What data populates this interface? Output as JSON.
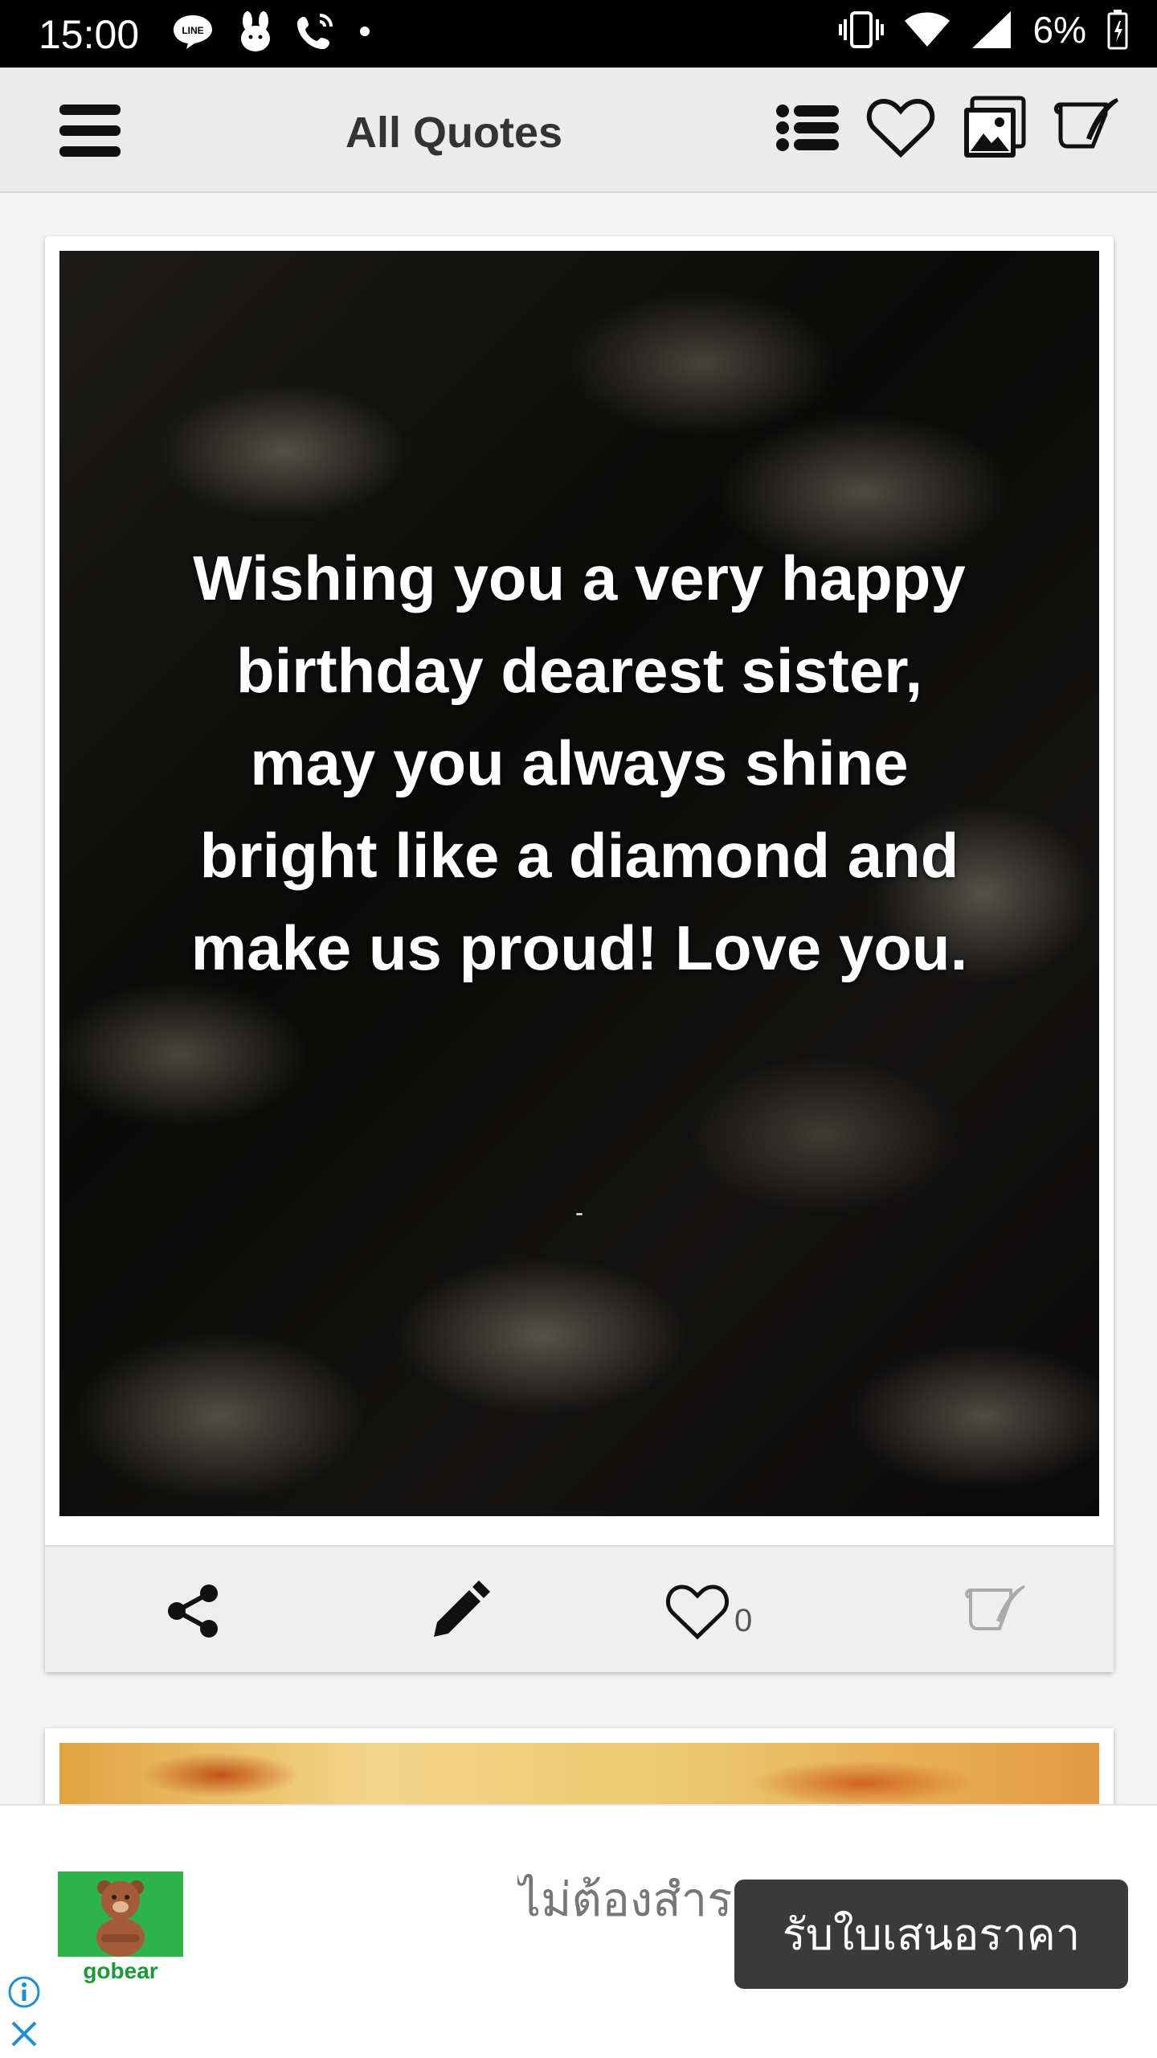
{
  "status_bar": {
    "time": "15:00",
    "battery": "6%",
    "left_icons": [
      "line-icon",
      "bunny-icon",
      "wifi-call-icon",
      "dot-icon"
    ],
    "right_icons": [
      "vibrate-icon",
      "wifi-icon",
      "signal-icon",
      "battery-icon"
    ]
  },
  "app_bar": {
    "title": "All Quotes",
    "icons": [
      "menu-icon",
      "list-icon",
      "heart-icon",
      "gallery-icon",
      "write-icon"
    ]
  },
  "quote_card": {
    "text": "Wishing you a very happy birthday dearest sister, may you always shine bright like a diamond and make us proud! Love you.",
    "author": "-",
    "like_count": "0",
    "actions": [
      "share-icon",
      "edit-icon",
      "heart-icon",
      "write-icon"
    ]
  },
  "ad": {
    "brand": "gobear",
    "copy": "ไม่ต้องสำรวจ เลย คลิก",
    "cta": "รับใบเสนอราคา",
    "colors": {
      "brand_green": "#2db34a",
      "cta_bg": "#3a3a3a"
    }
  }
}
